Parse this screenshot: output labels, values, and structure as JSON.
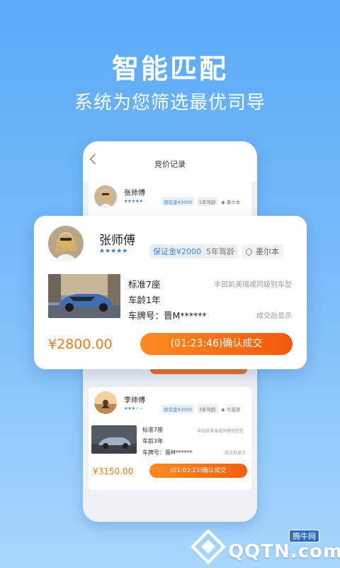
{
  "promo": {
    "headline": "智能匹配",
    "subline": "系统为您筛选最优司导"
  },
  "phone": {
    "title": "竞价记录",
    "card_top": {
      "driver_name": "张师傅",
      "rating": 5,
      "deposit_tag": "保证金¥2000",
      "experience_tag": "5年驾龄",
      "location": "墨尔本"
    },
    "card_bottom": {
      "driver_name": "李师傅",
      "rating": 3,
      "deposit_tag": "保证金¥2000",
      "experience_tag": "3年驾龄",
      "location": "华盛顿",
      "car_type": "标准7座",
      "car_model": "丰田凯美瑞或同级别车型",
      "car_age": "车龄3年",
      "plate_label": "车牌号：晋M******",
      "plate_note": "成交后显示",
      "price": "¥3150.00",
      "button_label": "(01:03:23)确认成交"
    }
  },
  "featured_card": {
    "driver_name": "张师傅",
    "rating": 5,
    "deposit_tag": "保证金¥2000",
    "experience_tag": "5年驾龄",
    "location": "墨尔本",
    "car_type": "标准7座",
    "car_model": "丰田凯美瑞或同级别车型",
    "car_age": "车龄1年",
    "plate_label": "车牌号：晋M******",
    "plate_note": "成交后显示",
    "price": "¥2800.00",
    "button_label": "(01:23:46)确认成交"
  },
  "watermark": {
    "badge": "腾牛网",
    "text": "QQTN.com"
  },
  "colors": {
    "accent_orange": "#f07a1a",
    "star_blue": "#3a78d8",
    "background_blue": "#5aa9f7"
  }
}
